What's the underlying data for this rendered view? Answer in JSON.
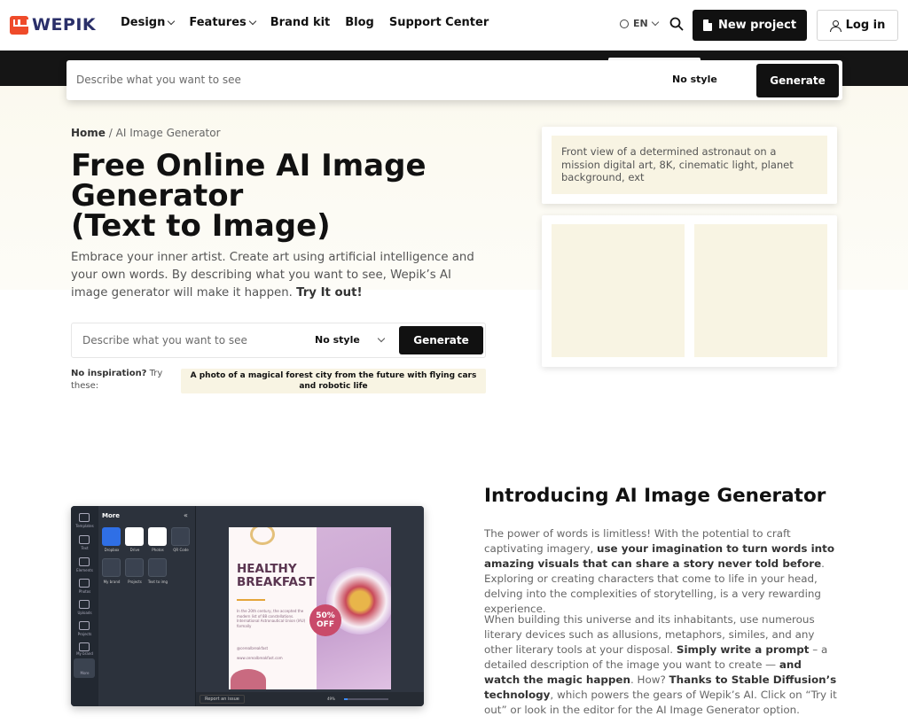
{
  "brand": {
    "name": "WEPIK",
    "accent": "#ef4b2a",
    "text_color": "#2a2f69"
  },
  "nav": {
    "items": [
      {
        "label": "Design",
        "dropdown": true
      },
      {
        "label": "Features",
        "dropdown": true
      },
      {
        "label": "Brand kit",
        "dropdown": false
      },
      {
        "label": "Blog",
        "dropdown": false
      },
      {
        "label": "Support Center",
        "dropdown": false
      }
    ],
    "language": "EN",
    "new_project": "New project",
    "login": "Log in"
  },
  "sticky_prompt": {
    "placeholder": "Describe what you want to see",
    "style_value": "No style",
    "generate": "Generate"
  },
  "breadcrumb": {
    "home": "Home",
    "separator": "/",
    "current": "AI Image Generator"
  },
  "hero": {
    "title_lines": [
      "Free Online AI Image",
      "Generator",
      "(Text to Image)"
    ],
    "lead": "Embrace your inner artist. Create art using artificial intelligence and your own words. By describing what you want to see, Wepik’s AI image generator will make it happen.",
    "lead_cta": "Try It out!"
  },
  "prompt": {
    "placeholder": "Describe what you want to see",
    "style_value": "No style",
    "generate": "Generate"
  },
  "inspiration": {
    "label_bold": "No inspiration?",
    "label_rest": "Try these:",
    "suggestion": "A photo of a magical forest city from the future with flying cars and robotic life"
  },
  "preview": {
    "prompt_text": "Front view of a determined astronaut on a mission digital art, 8K, cinematic light, planet background, ext"
  },
  "editor_mock": {
    "panel_title": "More",
    "rail": [
      "Templates",
      "Text",
      "Elements",
      "Photos",
      "Uploads",
      "Projects",
      "My brand",
      "More"
    ],
    "tiles": [
      "Dropbox",
      "Drive",
      "Photos",
      "QR Code",
      "My brand",
      "Projects",
      "Text to img"
    ],
    "report_issue": "Report an issue",
    "zoom": "49%",
    "design": {
      "headline_1": "HEALTHY",
      "headline_2": "BREAKFAST",
      "body": "In the 20th century, the accepted the modern list of 88 constellations. International Astronautical Union (IAU) formally",
      "social": "@cerealbreakfast",
      "url": "www.cerealbreakfast.com",
      "badge_value": "50%",
      "badge_label": "OFF"
    }
  },
  "intro": {
    "title": "Introducing AI Image Generator",
    "p1_a": "The power of words is limitless! With the potential to craft captivating imagery, ",
    "p1_b": "use your imagination to turn words into amazing visuals that can share a story never told before",
    "p1_c": ". Exploring or creating characters that come to life in your head, delving into the complexities of storytelling, is a very rewarding experience.",
    "p2_a": "When building this universe and its inhabitants, use numerous literary devices such as allusions, metaphors, similes, and any other literary tools at your disposal. ",
    "p2_b": "Simply write a prompt",
    "p2_c": " – a detailed description of the image you want to create — ",
    "p2_d": "and watch the magic happen",
    "p2_e": ". How? ",
    "p2_f": "Thanks to Stable Diffusion’s technology",
    "p2_g": ", which powers the gears of Wepik’s AI. Click on “Try it out” or look in the editor for the AI Image Generator option."
  }
}
